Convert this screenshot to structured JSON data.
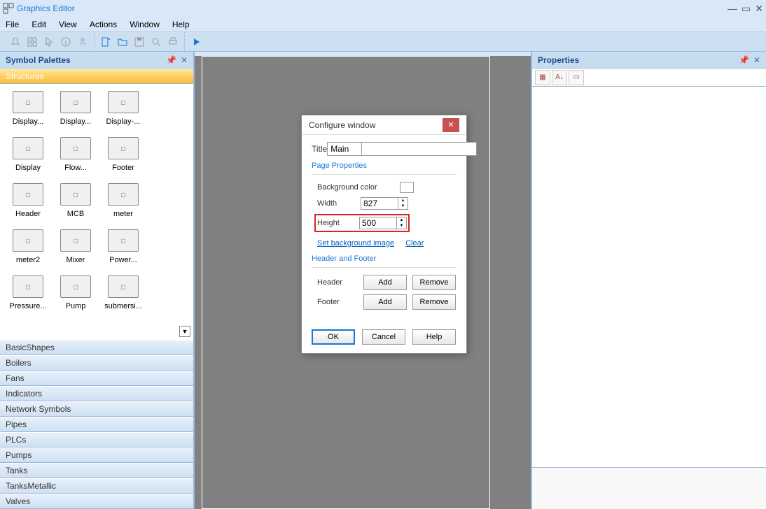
{
  "app_title": "Graphics Editor",
  "menu": [
    "File",
    "Edit",
    "View",
    "Actions",
    "Window",
    "Help"
  ],
  "left_panel": {
    "title": "Symbol Palettes",
    "active_category": "Structures",
    "categories": [
      "BasicShapes",
      "Boilers",
      "Fans",
      "Indicators",
      "Network Symbols",
      "Pipes",
      "PLCs",
      "Pumps",
      "Tanks",
      "TanksMetallic",
      "Valves"
    ],
    "items": [
      {
        "label": "Display..."
      },
      {
        "label": "Display..."
      },
      {
        "label": "Display-..."
      },
      {
        "label": "Display"
      },
      {
        "label": "Flow..."
      },
      {
        "label": "Footer"
      },
      {
        "label": "Header"
      },
      {
        "label": "MCB"
      },
      {
        "label": "meter"
      },
      {
        "label": "meter2"
      },
      {
        "label": "Mixer"
      },
      {
        "label": "Power..."
      },
      {
        "label": "Pressure..."
      },
      {
        "label": "Pump"
      },
      {
        "label": "submersi..."
      }
    ]
  },
  "right_panel": {
    "title": "Properties"
  },
  "dialog": {
    "title": "Configure window",
    "title_label": "Title",
    "title_value": "Main",
    "page_props_label": "Page Properties",
    "bg_label": "Background color",
    "width_label": "Width",
    "width_value": "827",
    "height_label": "Height",
    "height_value": "500",
    "set_bg_link": "Set background image",
    "clear_link": "Clear",
    "hf_label": "Header and Footer",
    "header_label": "Header",
    "footer_label": "Footer",
    "add_label": "Add",
    "remove_label": "Remove",
    "ok": "OK",
    "cancel": "Cancel",
    "help": "Help"
  }
}
